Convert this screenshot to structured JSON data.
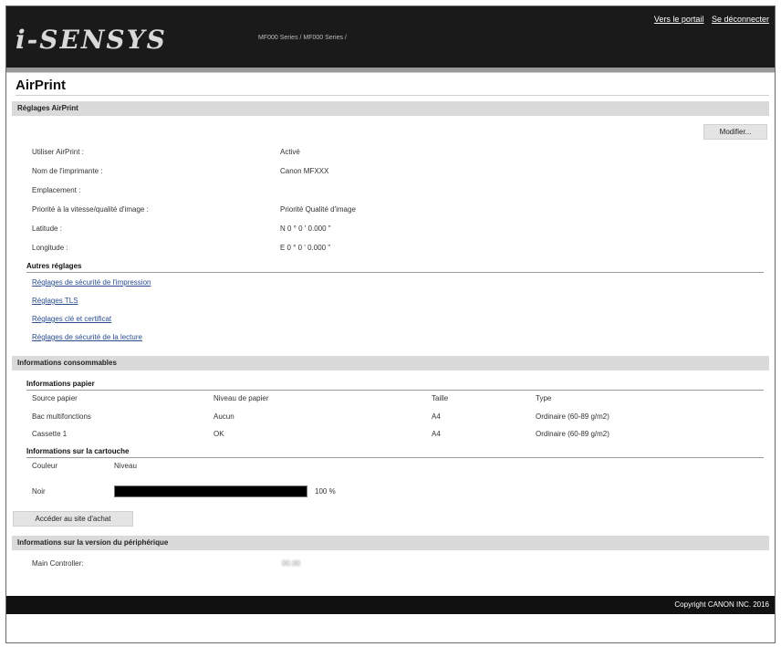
{
  "header": {
    "logo": "i-SENSYS",
    "model": "MF000 Series / MF000 Series /",
    "links": {
      "portal": "Vers le portail",
      "logout": "Se déconnecter"
    }
  },
  "page": {
    "title": "AirPrint"
  },
  "airprint": {
    "section": "Réglages AirPrint",
    "edit_button": "Modifier...",
    "rows": [
      {
        "label": "Utiliser AirPrint :",
        "value": "Activé"
      },
      {
        "label": "Nom de l'imprimante :",
        "value": "Canon MFXXX"
      },
      {
        "label": "Emplacement :",
        "value": ""
      },
      {
        "label": "Priorité à la vitesse/qualité d'image :",
        "value": "Priorité Qualité d'image"
      },
      {
        "label": "Latitude :",
        "value": "N 0 ° 0 ' 0.000 \""
      },
      {
        "label": "Longitude :",
        "value": "E 0 ° 0 ' 0.000 \""
      }
    ]
  },
  "other": {
    "title": "Autres réglages",
    "links": [
      "Réglages de sécurité de l'impression",
      "Réglages TLS",
      "Réglages clé et certificat",
      "Réglages de sécurité de la lecture"
    ]
  },
  "consumables": {
    "section": "Informations consommables",
    "paper_title": "Informations papier",
    "paper_headers": [
      "Source papier",
      "Niveau de papier",
      "Taille",
      "Type"
    ],
    "paper_rows": [
      [
        "Bac multifonctions",
        "Aucun",
        "A4",
        "Ordinaire (60-89 g/m2)"
      ],
      [
        "Cassette 1",
        "OK",
        "A4",
        "Ordinaire (60-89 g/m2)"
      ]
    ],
    "cartridge_title": "Informations sur la cartouche",
    "cartridge_headers": [
      "Couleur",
      "Niveau"
    ],
    "cartridge": {
      "color": "Noir",
      "level": "100 %",
      "level_fraction": 1.0
    },
    "purchase_button": "Accéder au site d'achat"
  },
  "version": {
    "section": "Informations sur la version du périphérique",
    "label": "Main Controller:",
    "value": "00.00"
  },
  "footer": {
    "copyright": "Copyright CANON INC. 2016"
  }
}
